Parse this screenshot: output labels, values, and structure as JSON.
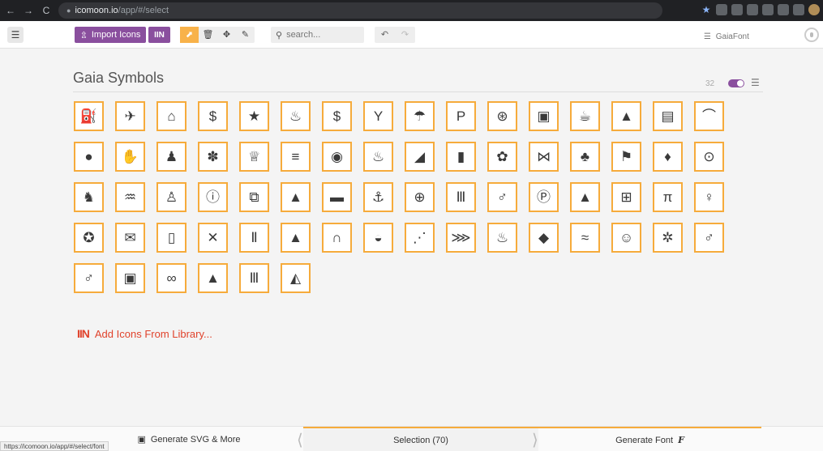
{
  "browser": {
    "back": "←",
    "forward": "→",
    "reload": "C",
    "url_host": "icomoon.io",
    "url_path": "/app/#/select"
  },
  "toolbar": {
    "menu_icon": "☰",
    "import_label": "Import Icons",
    "library_label": "IIN",
    "search_placeholder": "search...",
    "font_name": "GaiaFont"
  },
  "set": {
    "title": "Gaia Symbols",
    "count": "32"
  },
  "icons": [
    [
      "fuel-pump-icon",
      "⛽"
    ],
    [
      "airplane-icon",
      "✈"
    ],
    [
      "house-tree-icon",
      "⌂"
    ],
    [
      "dollar-icon",
      "$"
    ],
    [
      "star-icon",
      "★"
    ],
    [
      "bakery-icon",
      "♨"
    ],
    [
      "money-bag-icon",
      "$"
    ],
    [
      "cocktail-icon",
      "Y"
    ],
    [
      "beach-umbrella-icon",
      "☂"
    ],
    [
      "bicycle-parking-icon",
      "P"
    ],
    [
      "wheel-icon",
      "⊛"
    ],
    [
      "bus-icon",
      "▣"
    ],
    [
      "cafe-icon",
      "☕"
    ],
    [
      "camping-icon",
      "▲"
    ],
    [
      "caravan-icon",
      "▤"
    ],
    [
      "tent-icon",
      "⌒"
    ],
    [
      "cinema-icon",
      "●"
    ],
    [
      "climbing-icon",
      "✋"
    ],
    [
      "museum-guide-icon",
      "♟"
    ],
    [
      "paw-icon",
      "✽"
    ],
    [
      "drink-icon",
      "♕"
    ],
    [
      "burger-icon",
      "≡"
    ],
    [
      "ferry-icon",
      "◉"
    ],
    [
      "fire-icon",
      "♨"
    ],
    [
      "fishing-icon",
      "◢"
    ],
    [
      "gas-station-icon",
      "▮"
    ],
    [
      "flower-icon",
      "✿"
    ],
    [
      "hammock-icon",
      "⋈"
    ],
    [
      "tree-icon",
      "♣"
    ],
    [
      "golf-icon",
      "⚑"
    ],
    [
      "grocery-icon",
      "♦"
    ],
    [
      "scout-icon",
      "⊙"
    ],
    [
      "horse-riding-icon",
      "♞"
    ],
    [
      "hot-spring-icon",
      "♒"
    ],
    [
      "ice-cream-icon",
      "♙"
    ],
    [
      "info-icon",
      "ⓘ"
    ],
    [
      "library-icon",
      "⧉"
    ],
    [
      "lighthouse-icon",
      "▲"
    ],
    [
      "bed-icon",
      "▬"
    ],
    [
      "anchor-icon",
      "⚓"
    ],
    [
      "first-aid-icon",
      "⊕"
    ],
    [
      "monument-icon",
      "Ⅲ"
    ],
    [
      "hiking-icon",
      "♂"
    ],
    [
      "parking-icon",
      "Ⓟ"
    ],
    [
      "mountain-icon",
      "▲"
    ],
    [
      "pharmacy-icon",
      "⊞"
    ],
    [
      "picnic-icon",
      "π"
    ],
    [
      "playground-icon",
      "♀"
    ],
    [
      "police-icon",
      "✪"
    ],
    [
      "post-icon",
      "✉"
    ],
    [
      "pub-icon",
      "▯"
    ],
    [
      "tools-icon",
      "✕"
    ],
    [
      "restaurant-icon",
      "Ⅱ"
    ],
    [
      "shelter-icon",
      "▲"
    ],
    [
      "gazebo-icon",
      "∩"
    ],
    [
      "shopping-basket-icon",
      "◒"
    ],
    [
      "skiing-icon",
      "⋰"
    ],
    [
      "skating-icon",
      "⋙"
    ],
    [
      "spa-icon",
      "♨"
    ],
    [
      "rock-icon",
      "◆"
    ],
    [
      "swimming-icon",
      "≈"
    ],
    [
      "theater-icon",
      "☺"
    ],
    [
      "ferris-wheel-icon",
      "✲"
    ],
    [
      "toilets-icon",
      "♂"
    ],
    [
      "walking-icon",
      "♂"
    ],
    [
      "train-icon",
      "▣"
    ],
    [
      "binoculars-icon",
      "∞"
    ],
    [
      "volcano-icon",
      "▲"
    ],
    [
      "waterfall-icon",
      "Ⅲ"
    ],
    [
      "viewpoint-icon",
      "◭"
    ]
  ],
  "add_library_label": "Add Icons From Library...",
  "bottom": {
    "generate_svg": "Generate SVG & More",
    "selection": "Selection (70)",
    "generate_font": "Generate Font",
    "font_glyph": "F"
  },
  "status_url": "https://icomoon.io/app/#/select/font",
  "colors": {
    "accent_orange": "#f6ab3b",
    "brand_purple": "#8a4f9e",
    "link_red": "#e0432c"
  }
}
